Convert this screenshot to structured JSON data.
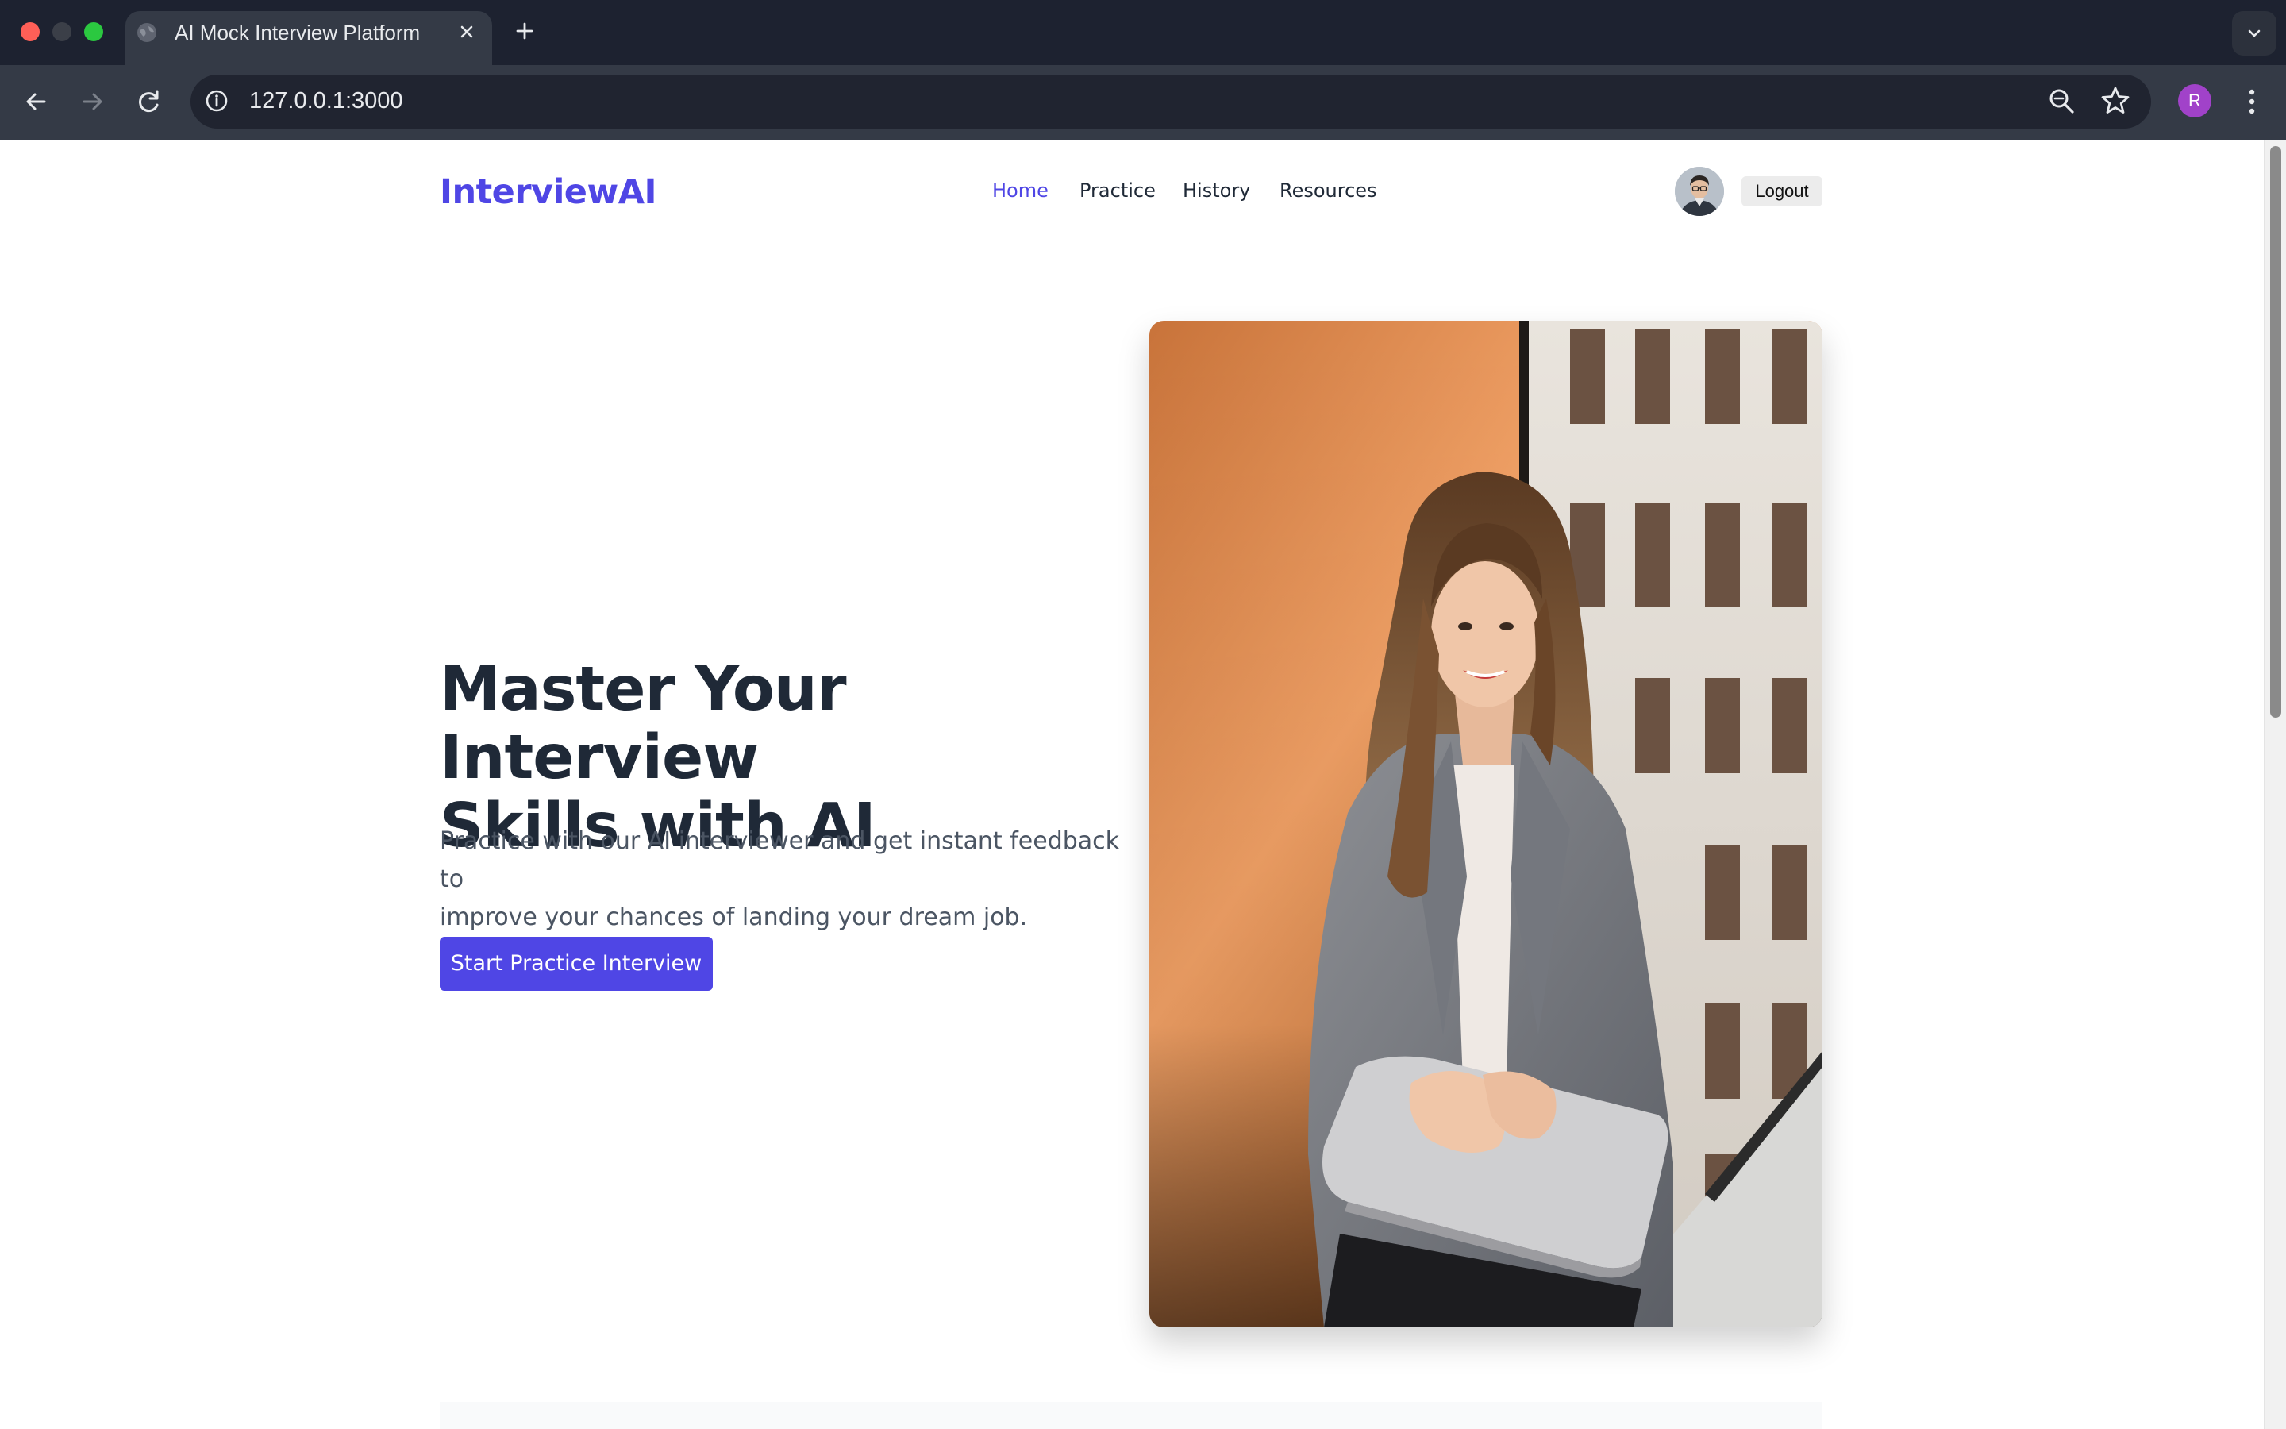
{
  "browser": {
    "tab_title": "AI Mock Interview Platform",
    "url": "127.0.0.1:3000",
    "profile_initial": "R"
  },
  "header": {
    "logo": "InterviewAI",
    "nav": [
      {
        "label": "Home",
        "active": true
      },
      {
        "label": "Practice",
        "active": false
      },
      {
        "label": "History",
        "active": false
      },
      {
        "label": "Resources",
        "active": false
      }
    ],
    "logout_label": "Logout"
  },
  "hero": {
    "title_line1": "Master Your Interview",
    "title_line2": "Skills with AI",
    "subtitle_line1": "Practice with our AI interviewer and get instant feedback to",
    "subtitle_line2": "improve your chances of landing your dream job.",
    "cta_label": "Start Practice Interview"
  },
  "colors": {
    "brand": "#4f46e5",
    "heading": "#1f2937",
    "body_text": "#4b5563",
    "chrome_dark": "#1d2230",
    "chrome_toolbar": "#343a46"
  },
  "icons": [
    "globe-icon",
    "close-icon",
    "plus-icon",
    "chevron-down-icon",
    "back-arrow-icon",
    "forward-arrow-icon",
    "reload-icon",
    "info-icon",
    "zoom-icon",
    "star-icon",
    "kebab-menu-icon"
  ]
}
